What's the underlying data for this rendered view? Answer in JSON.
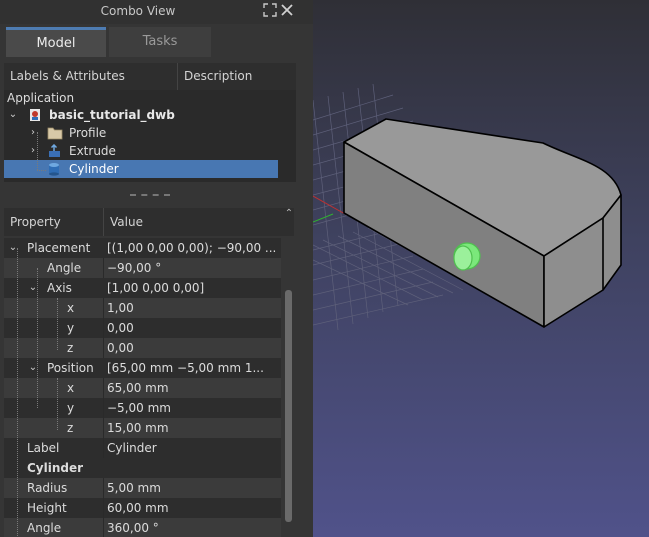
{
  "panel": {
    "title": "Combo View"
  },
  "tabs": {
    "model": "Model",
    "tasks": "Tasks"
  },
  "tree": {
    "col_labels": "Labels & Attributes",
    "col_description": "Description",
    "application": "Application",
    "document": "basic_tutorial_dwb",
    "items": [
      {
        "label": "Profile",
        "icon": "folder-icon"
      },
      {
        "label": "Extrude",
        "icon": "extrude-icon"
      },
      {
        "label": "Cylinder",
        "icon": "cylinder-icon",
        "selected": true
      }
    ]
  },
  "properties": {
    "col_property": "Property",
    "col_value": "Value",
    "rows": [
      {
        "name": "Placement",
        "value": "[(1,00 0,00 0,00); −90,00 ..."
      },
      {
        "name": "Angle",
        "value": "−90,00 °"
      },
      {
        "name": "Axis",
        "value": "[1,00 0,00 0,00]"
      },
      {
        "name": "x",
        "value": "1,00"
      },
      {
        "name": "y",
        "value": "0,00"
      },
      {
        "name": "z",
        "value": "0,00"
      },
      {
        "name": "Position",
        "value": "[65,00 mm  −5,00 mm  1..."
      },
      {
        "name": "x",
        "value": "65,00 mm"
      },
      {
        "name": "y",
        "value": "−5,00 mm"
      },
      {
        "name": "z",
        "value": "15,00 mm"
      },
      {
        "name": "Label",
        "value": "Cylinder"
      },
      {
        "name": "Cylinder",
        "value": ""
      },
      {
        "name": "Radius",
        "value": "5,00 mm"
      },
      {
        "name": "Height",
        "value": "60,00 mm"
      },
      {
        "name": "Angle",
        "value": "360,00 °"
      }
    ]
  },
  "colors": {
    "selection": "#4877b2",
    "model_body": "#8c8c8c",
    "cylinder_highlight": "#7be87b"
  }
}
